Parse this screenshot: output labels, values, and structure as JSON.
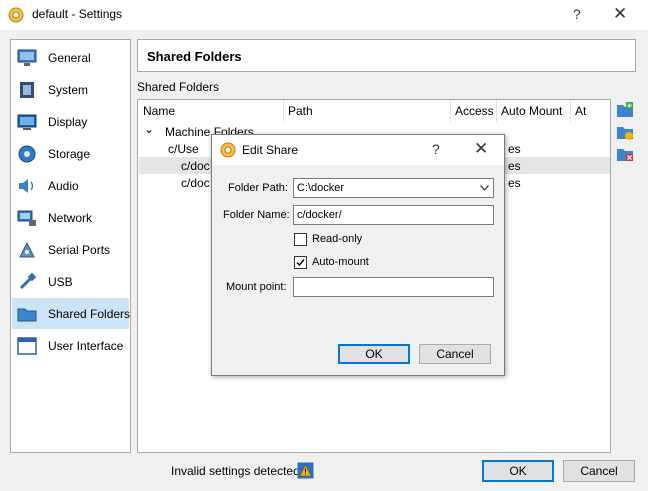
{
  "window": {
    "title": "default - Settings",
    "help": "?",
    "close": "✕"
  },
  "sidebar": {
    "items": [
      {
        "label": "General",
        "icon": "monitor-icon"
      },
      {
        "label": "System",
        "icon": "chip-icon"
      },
      {
        "label": "Display",
        "icon": "display-icon"
      },
      {
        "label": "Storage",
        "icon": "storage-icon"
      },
      {
        "label": "Audio",
        "icon": "speaker-icon"
      },
      {
        "label": "Network",
        "icon": "network-icon"
      },
      {
        "label": "Serial Ports",
        "icon": "serial-port-icon"
      },
      {
        "label": "USB",
        "icon": "usb-icon"
      },
      {
        "label": "Shared Folders",
        "icon": "folder-icon"
      },
      {
        "label": "User Interface",
        "icon": "window-icon"
      }
    ],
    "selected": "Shared Folders"
  },
  "header": {
    "title": "Shared Folders"
  },
  "group": {
    "label": "Shared Folders"
  },
  "tree": {
    "columns": [
      "Name",
      "Path",
      "Access",
      "Auto Mount",
      "At"
    ],
    "group_row": {
      "expander": "⌄",
      "label": "Machine Folders"
    },
    "rows": [
      {
        "name": "c/Use",
        "automount": "es"
      },
      {
        "name": "c/doc",
        "automount": "es"
      },
      {
        "name": "c/doc",
        "automount": "es"
      }
    ]
  },
  "toolbar": {
    "icons": [
      "add-folder-icon",
      "edit-folder-icon",
      "remove-folder-icon"
    ]
  },
  "status": {
    "text": "Invalid settings detected"
  },
  "buttons": {
    "ok": "OK",
    "cancel": "Cancel"
  },
  "dialog": {
    "title": "Edit Share",
    "help": "?",
    "close": "✕",
    "folder_path_label": "Folder Path:",
    "folder_path_value": "C:\\docker",
    "folder_name_label": "Folder Name:",
    "folder_name_value": "c/docker/",
    "readonly_label": "Read-only",
    "readonly_checked": false,
    "automount_label": "Auto-mount",
    "automount_checked": true,
    "mount_point_label": "Mount point:",
    "mount_point_value": "",
    "ok": "OK",
    "cancel": "Cancel"
  },
  "colors": {
    "selection": "#cce4f7",
    "accent": "#0078d7",
    "warning": "#f3b100"
  }
}
